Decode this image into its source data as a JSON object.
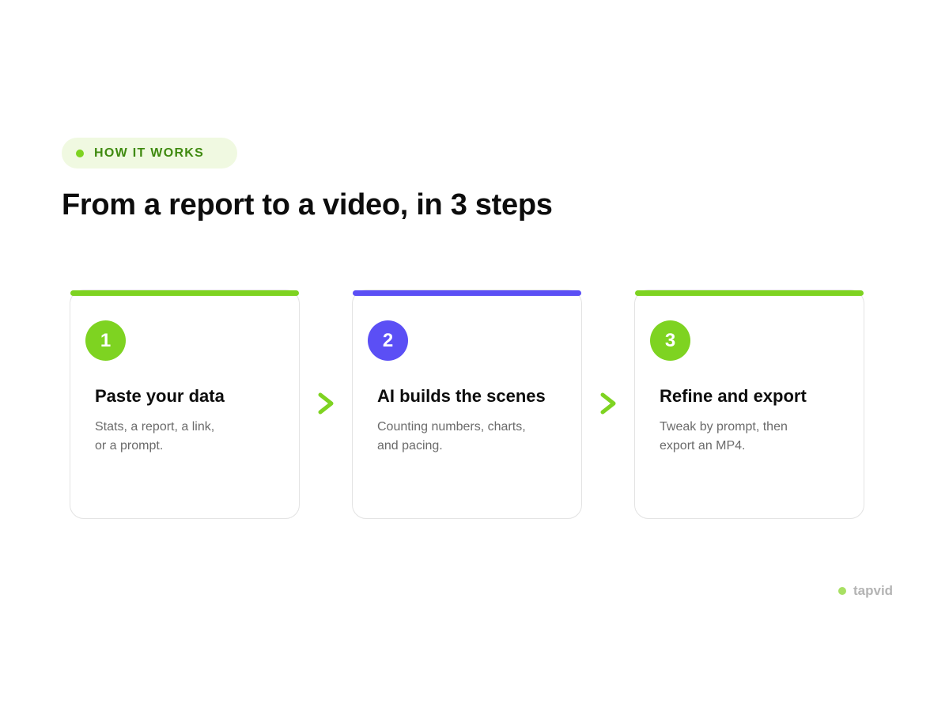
{
  "eyebrow": {
    "label": "HOW IT WORKS",
    "dot_color": "#7ed321"
  },
  "headline": "From a report to a video, in 3 steps",
  "steps": [
    {
      "number": "1",
      "title": "Paste your data",
      "description_lines": [
        "Stats, a report, a link,",
        "or a prompt."
      ],
      "accent_color": "#7ed321"
    },
    {
      "number": "2",
      "title": "AI builds the scenes",
      "description_lines": [
        "Counting numbers, charts,",
        "and pacing."
      ],
      "accent_color": "#5b4ff5"
    },
    {
      "number": "3",
      "title": "Refine and export",
      "description_lines": [
        "Tweak by prompt, then",
        "export an MP4."
      ],
      "accent_color": "#7ed321"
    }
  ],
  "arrows": {
    "icon": "chevron-right-icon",
    "color": "#7ed321"
  },
  "brand": {
    "name": "tapvid",
    "dot_color": "#a8e063"
  }
}
